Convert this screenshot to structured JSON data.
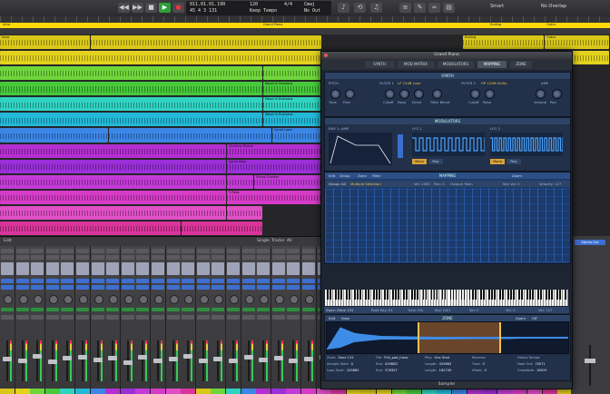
{
  "transport": {
    "lcd_position": "011.01.01.190",
    "lcd_sub": "45 4 3 131",
    "lcd_tempo": "120",
    "lcd_tempo_label": "Keep Tempo",
    "lcd_sig": "4/4",
    "lcd_key": "Cmaj",
    "lcd_key_label": "No Out",
    "right_labels": [
      "Smart",
      "No Overlap"
    ]
  },
  "ruler": {
    "markers": [
      "Intro",
      "Grand Piano",
      "Ending",
      "Outro",
      "Verse"
    ],
    "region_label": "Grand Piano"
  },
  "tracks": [
    {
      "color": "#d9c81a",
      "regions": [
        [
          0,
          100,
          "Intro"
        ],
        [
          100,
          355,
          ""
        ],
        [
          510,
          600,
          "Ending"
        ],
        [
          600,
          672,
          "Outro"
        ]
      ]
    },
    {
      "color": "#e2d21e",
      "regions": [
        [
          0,
          355,
          ""
        ],
        [
          460,
          600,
          ""
        ],
        [
          600,
          672,
          ""
        ]
      ]
    },
    {
      "color": "#6fd63a",
      "regions": [
        [
          0,
          290,
          ""
        ],
        [
          290,
          355,
          ""
        ]
      ]
    },
    {
      "color": "#46c93b",
      "regions": [
        [
          0,
          290,
          ""
        ],
        [
          290,
          355,
          "Wood in Sessions"
        ]
      ]
    },
    {
      "color": "#2fd3c0",
      "regions": [
        [
          0,
          290,
          ""
        ],
        [
          290,
          355,
          "Wood in Business"
        ]
      ]
    },
    {
      "color": "#23b8d8",
      "regions": [
        [
          0,
          290,
          ""
        ],
        [
          290,
          355,
          "Wood in Business"
        ]
      ]
    },
    {
      "color": "#3c86e6",
      "regions": [
        [
          0,
          120,
          ""
        ],
        [
          120,
          300,
          ""
        ],
        [
          300,
          355,
          "Synth Lead"
        ]
      ]
    },
    {
      "color": "#b42fd1",
      "regions": [
        [
          0,
          250,
          ""
        ],
        [
          250,
          355,
          "Stummy Bustle"
        ]
      ]
    },
    {
      "color": "#9b2fd8",
      "regions": [
        [
          0,
          250,
          ""
        ],
        [
          250,
          355,
          "Synth Bass"
        ]
      ]
    },
    {
      "color": "#c23bd6",
      "regions": [
        [
          0,
          250,
          ""
        ],
        [
          250,
          280,
          ""
        ],
        [
          280,
          355,
          "String Quarter"
        ]
      ]
    },
    {
      "color": "#d63cc8",
      "regions": [
        [
          0,
          250,
          ""
        ],
        [
          250,
          355,
          "Y Pads"
        ]
      ]
    },
    {
      "color": "#e04fc6",
      "regions": [
        [
          0,
          250,
          ""
        ],
        [
          250,
          290,
          ""
        ]
      ]
    },
    {
      "color": "#d9359b",
      "regions": [
        [
          0,
          200,
          ""
        ],
        [
          200,
          290,
          ""
        ]
      ]
    }
  ],
  "mixer": {
    "tabs": [
      "Edit",
      "Single",
      "Tracks",
      "All"
    ],
    "strip_names": [
      "Channel EQ",
      "Compressor",
      "Channel EQ",
      "Channel EQ",
      "Channel EQ",
      "Channel EQ",
      "Channel EQ",
      "Vinyl",
      "Channel EQ",
      "Channel EQ",
      "Compressor",
      "Channel EQ",
      "Channel EQ",
      "Channel EQ",
      "Channel EQ",
      "Channel EQ",
      "Channel EQ",
      "Channel EQ",
      "Channel EQ",
      "Channel EQ",
      "Channel EQ",
      "Compressor",
      "Channel EQ",
      "Channel EQ",
      "Channel EQ"
    ],
    "strip_colors": [
      "#d9c81a",
      "#e2d21e",
      "#6fd63a",
      "#46c93b",
      "#2fd3c0",
      "#23b8d8",
      "#3c86e6",
      "#b42fd1",
      "#9b2fd8",
      "#c23bd6",
      "#d63cc8",
      "#e04fc6",
      "#d9359b",
      "#d9c81a",
      "#6fd63a",
      "#2fd3c0",
      "#3c86e6",
      "#b42fd1",
      "#9b2fd8",
      "#c23bd6",
      "#d63cc8",
      "#e04fc6",
      "#d9359b",
      "#e2d21e"
    ],
    "fader_levels": [
      0.55,
      0.5,
      0.62,
      0.48,
      0.58,
      0.6,
      0.52,
      0.57,
      0.45,
      0.6,
      0.5,
      0.55,
      0.63,
      0.5,
      0.56,
      0.49,
      0.6,
      0.53,
      0.58,
      0.5,
      0.55,
      0.61,
      0.47,
      0.54
    ],
    "right_label": "Stereo Out"
  },
  "sampler": {
    "title": "Grand Piano",
    "footer": "Sampler",
    "tabs": [
      "SYNTH",
      "MOD MATRIX",
      "MODULATORS",
      "MAPPING",
      "ZONE"
    ],
    "active_tab": "MAPPING",
    "synth": {
      "header": "SYNTH",
      "labels": [
        "PITCH",
        "FILTER 1",
        "LP 12dB Lush",
        "FILTER 2",
        "HP 12dB Utility",
        "AMP"
      ],
      "knobs": [
        "Tune",
        "Fine",
        "Cutoff",
        "Reso",
        "Drive",
        "Filter Blend",
        "Cutoff",
        "Reso",
        "Volume",
        "Pan"
      ]
    },
    "modulators": {
      "header": "MODULATORS",
      "labels": [
        "ENV 1: AMP",
        "LFO 1",
        "LFO 2",
        "Env",
        "LFO"
      ],
      "buttons": [
        "Mono",
        "Poly",
        "Mono",
        "Poly"
      ]
    },
    "mapping": {
      "header": "MAPPING",
      "toolbar": [
        "Edit",
        "Group",
        "Zone",
        "Filter",
        "Zoom"
      ],
      "group_label": "Group: All",
      "group_value": "Multiple Selection",
      "fields": [
        "Vel: 1000",
        "Pan: 0",
        "Output: Main",
        "Key Vol: 0",
        "Velocity: 127"
      ],
      "footer": [
        "Zone: Zone 131",
        "Root Key: E4",
        "Tune: 0%",
        "Key: G#1",
        "Vel: 0",
        "Vol: 0",
        "Vel: 127"
      ]
    },
    "zone": {
      "header": "ZONE",
      "toolbar": [
        "Edit",
        "View",
        "Zoom",
        "Off"
      ],
      "rows": [
        [
          [
            "Zone:",
            "Zone 131"
          ],
          [
            "File:",
            "F04_pad_f.wav"
          ],
          [
            "Play:",
            "One Shot"
          ],
          [
            "Reverse:",
            ""
          ],
          [
            "Follow Tempo:",
            ""
          ]
        ],
        [
          [
            "Sample Start:",
            "0"
          ],
          [
            "End:",
            "429883"
          ],
          [
            "Length:",
            "429883"
          ],
          [
            "Tune:",
            "0"
          ],
          [
            "Fade Out:",
            "70071"
          ]
        ],
        [
          [
            "Loop Start:",
            "105883"
          ],
          [
            "End:",
            "378357"
          ],
          [
            "Length:",
            "182749"
          ],
          [
            "Xfade:",
            "0"
          ],
          [
            "Crossfade:",
            "18919"
          ]
        ]
      ]
    }
  }
}
